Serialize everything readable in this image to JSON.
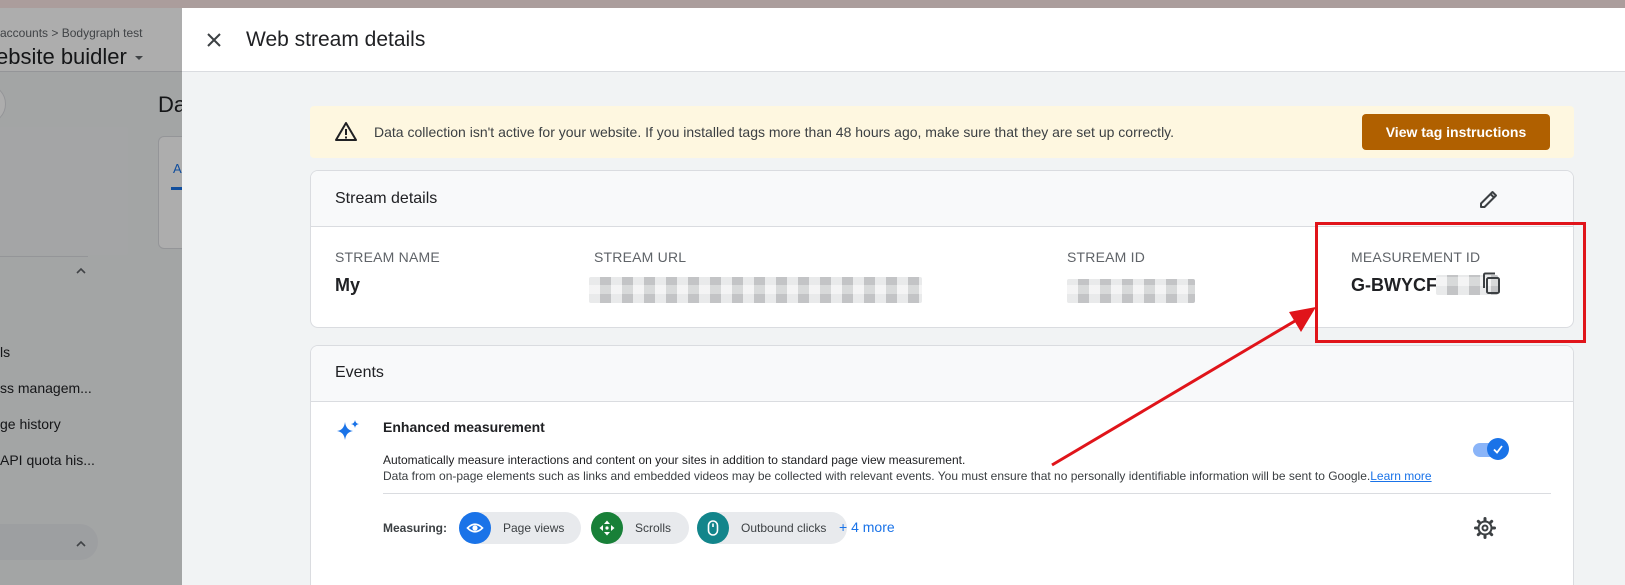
{
  "background": {
    "breadcrumb_part1": "accounts",
    "breadcrumb_sep": ">",
    "breadcrumb_part2": "Bodygraph test",
    "account_name": "ebsite buidler",
    "page_title_partial": "Da",
    "tab_partial": "A",
    "nav_items": [
      "ls",
      "ss managem...",
      "ge history",
      "API quota his..."
    ]
  },
  "dialog": {
    "title": "Web stream details",
    "banner": {
      "text": "Data collection isn't active for your website. If you installed tags more than 48 hours ago, make sure that they are set up correctly.",
      "button_label": "View tag instructions"
    },
    "stream_details": {
      "title": "Stream details",
      "fields": {
        "stream_name_label": "STREAM NAME",
        "stream_name_value": "My",
        "stream_url_label": "STREAM URL",
        "stream_id_label": "STREAM ID",
        "measurement_id_label": "MEASUREMENT ID",
        "measurement_id_value": "G-BWYCF"
      }
    },
    "events": {
      "title": "Events",
      "enhanced_measurement": {
        "title": "Enhanced measurement",
        "description_line1": "Automatically measure interactions and content on your sites in addition to standard page view measurement.",
        "description_line2": "Data from on-page elements such as links and embedded videos may be collected with relevant events. You must ensure that no personally identifiable information will be sent to Google.",
        "learn_more": "Learn more",
        "enabled": true
      },
      "measuring_label": "Measuring:",
      "chips": [
        {
          "label": "Page views",
          "icon": "eye-icon",
          "color": "#1a73e8"
        },
        {
          "label": "Scrolls",
          "icon": "scroll-icon",
          "color": "#188038"
        },
        {
          "label": "Outbound clicks",
          "icon": "mouse-icon",
          "color": "#12858b"
        }
      ],
      "more_link": "+ 4 more"
    }
  },
  "colors": {
    "accent": "#1a73e8",
    "warning_button": "#b06000",
    "banner_bg": "#fef7e0",
    "annotation": "#e0141a"
  }
}
